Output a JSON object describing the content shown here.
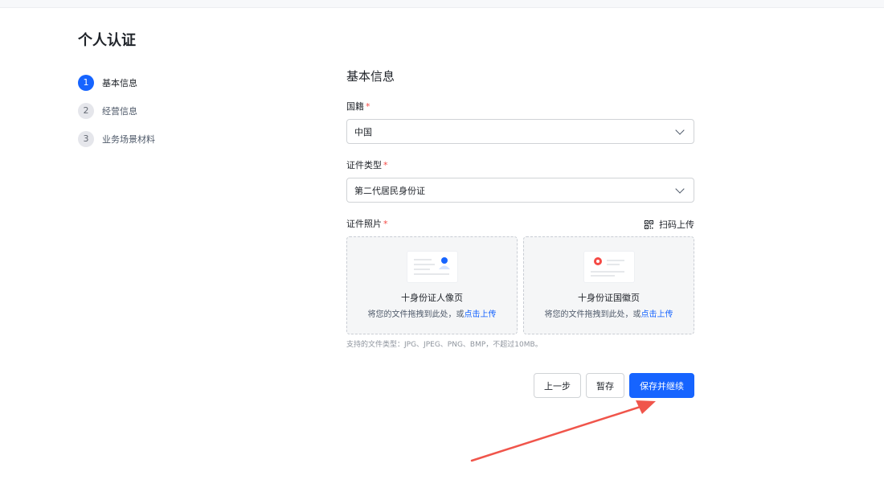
{
  "page": {
    "title": "个人认证"
  },
  "steps": [
    {
      "num": "1",
      "label": "基本信息",
      "active": true
    },
    {
      "num": "2",
      "label": "经营信息",
      "active": false
    },
    {
      "num": "3",
      "label": "业务场景材料",
      "active": false
    }
  ],
  "form": {
    "section_title": "基本信息",
    "nationality": {
      "label": "国籍",
      "required_mark": "*",
      "value": "中国"
    },
    "id_type": {
      "label": "证件类型",
      "required_mark": "*",
      "value": "第二代居民身份证"
    },
    "id_photo": {
      "label": "证件照片",
      "required_mark": "*",
      "scan_upload": "扫码上传",
      "front": {
        "title": "十身份证人像页",
        "hint": "将您的文件拖拽到此处，或",
        "hint_link": "点击上传"
      },
      "back": {
        "title": "十身份证国徽页",
        "hint": "将您的文件拖拽到此处，或",
        "hint_link": "点击上传"
      },
      "support_text": "支持的文件类型：JPG、JPEG、PNG、BMP，不超过10MB。"
    }
  },
  "actions": {
    "prev": "上一步",
    "save_draft": "暂存",
    "save_continue": "保存并继续"
  },
  "colors": {
    "primary": "#1664ff",
    "required": "#f54a45",
    "arrow": "#f0554b"
  }
}
